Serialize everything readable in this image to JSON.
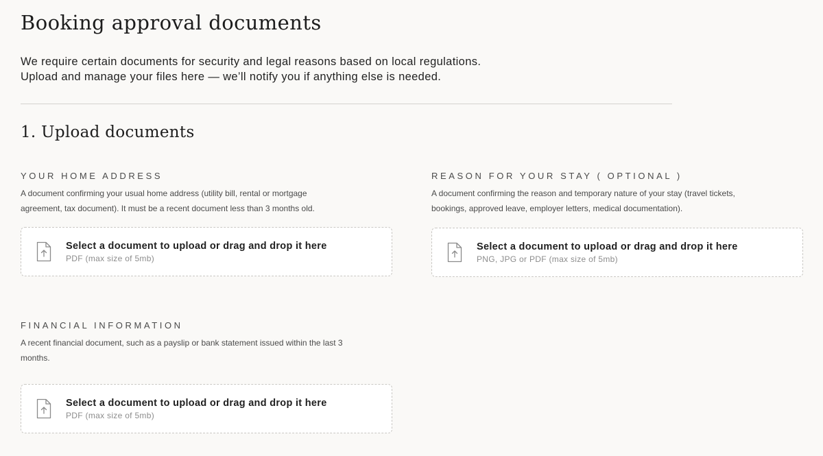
{
  "page": {
    "title": "Booking approval documents",
    "intro_line1": "We require certain documents for security and legal reasons based on local regulations.",
    "intro_line2": "Upload and manage your files here — we’ll notify you if anything else is needed."
  },
  "section": {
    "title": "1. Upload documents"
  },
  "documents": {
    "home_address": {
      "label": "YOUR HOME ADDRESS",
      "description": "A document confirming your usual home address (utility bill, rental or mortgage agreement, tax document). It must be a recent document less than 3 months old.",
      "upload_prompt": "Select a document to upload or drag and drop it here",
      "upload_hint": "PDF (max size of 5mb)",
      "icon": "file-upload-icon"
    },
    "reason_for_stay": {
      "label": "REASON FOR YOUR STAY ( OPTIONAL )",
      "description": "A document confirming the reason and temporary nature of your stay (travel tickets, bookings, approved leave, employer letters, medical documentation).",
      "upload_prompt": "Select a document to upload or drag and drop it here",
      "upload_hint": "PNG, JPG or PDF (max size of 5mb)",
      "icon": "file-upload-icon"
    },
    "financial_information": {
      "label": "FINANCIAL INFORMATION",
      "description": "A recent financial document, such as a payslip or bank statement issued within the last 3 months.",
      "upload_prompt": "Select a document to upload or drag and drop it here",
      "upload_hint": "PDF (max size of 5mb)",
      "icon": "file-upload-icon"
    }
  },
  "colors": {
    "background": "#faf9f7",
    "text": "#1f1f1f",
    "muted": "#8c8c8c",
    "border": "#c9c7c3",
    "dropzone": "#ffffff"
  }
}
